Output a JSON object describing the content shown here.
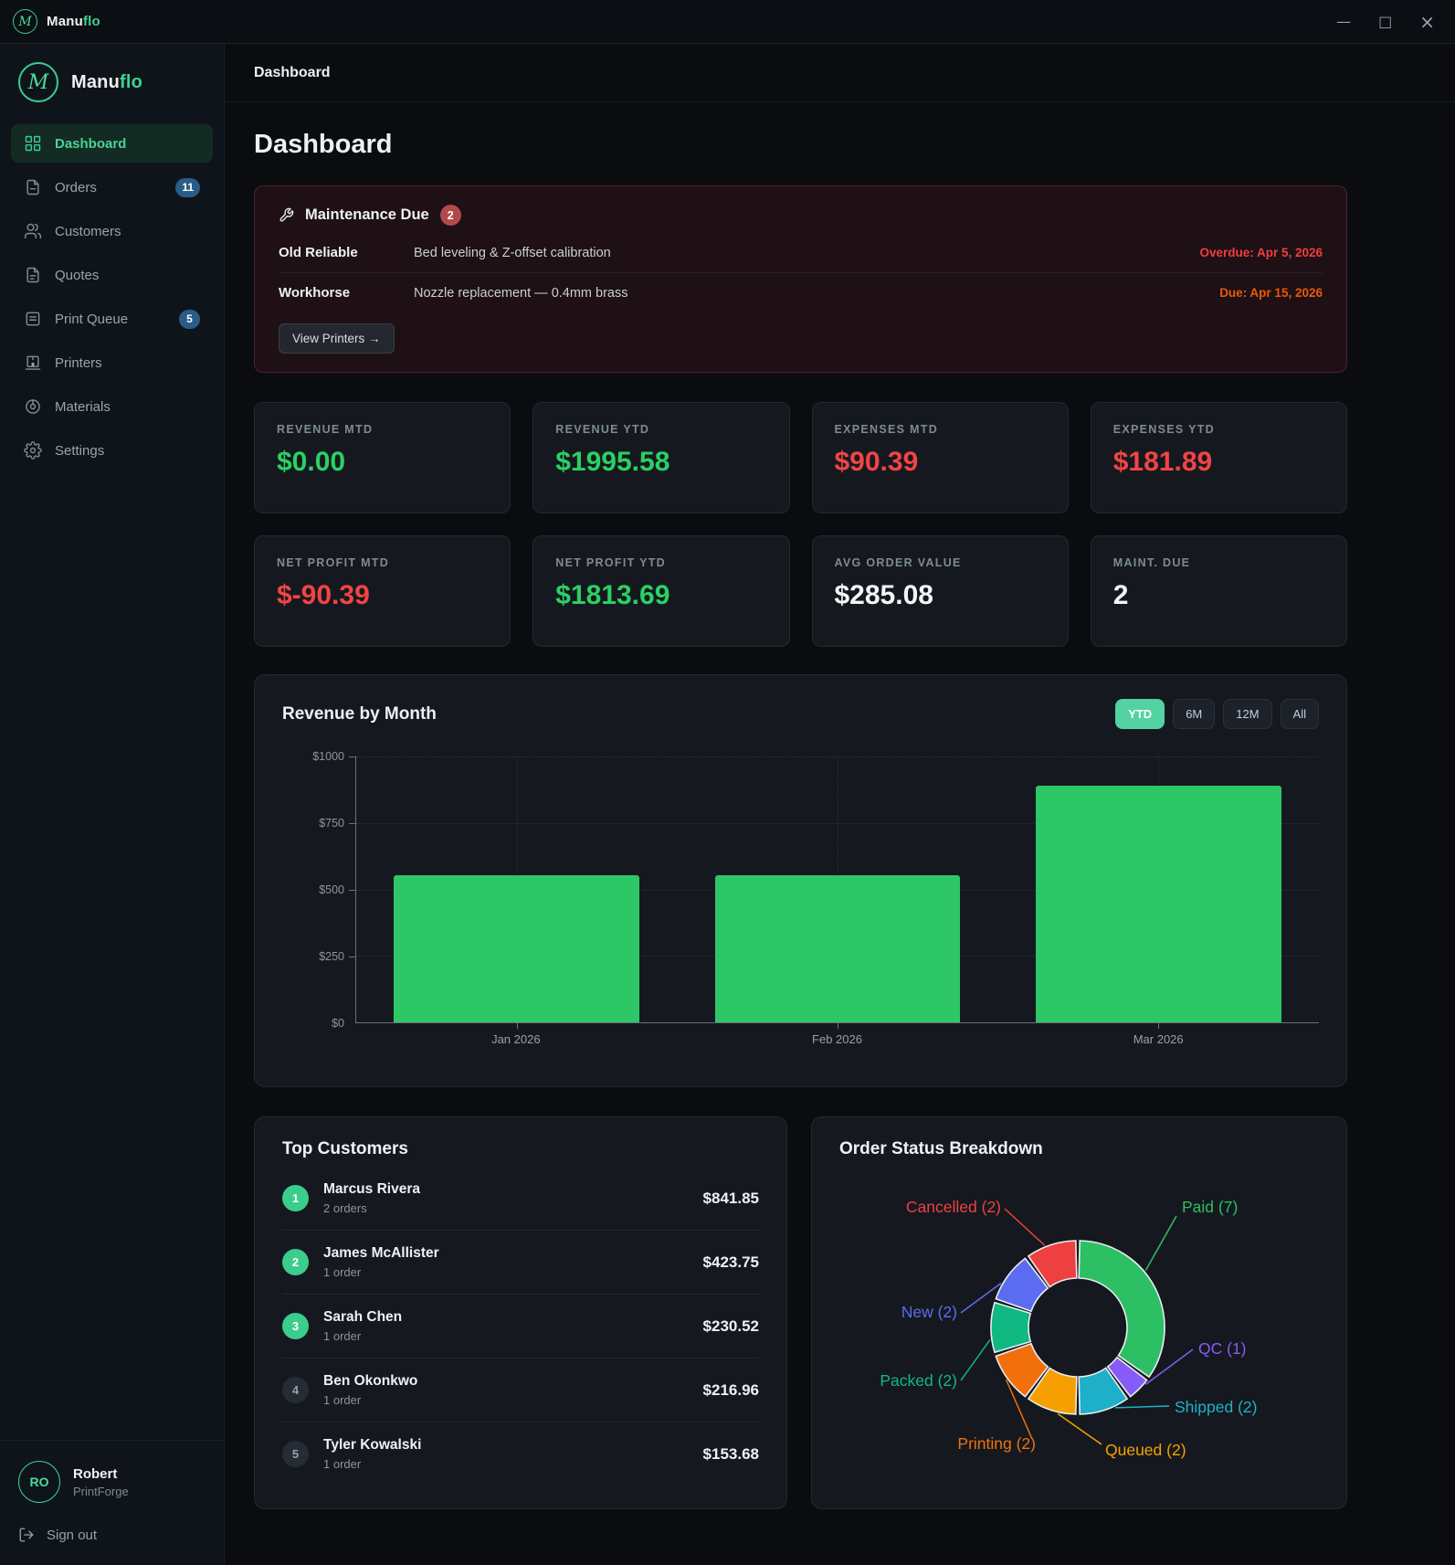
{
  "app": {
    "name_primary": "Manu",
    "name_accent": "flo",
    "logo_letter": "M"
  },
  "window_controls": {
    "minimize": "—",
    "maximize": "□",
    "close": "×"
  },
  "breadcrumb": "Dashboard",
  "page_title": "Dashboard",
  "sidebar": {
    "items": [
      {
        "label": "Dashboard",
        "icon": "dashboard-icon",
        "active": true
      },
      {
        "label": "Orders",
        "icon": "orders-icon",
        "badge": "11"
      },
      {
        "label": "Customers",
        "icon": "customers-icon"
      },
      {
        "label": "Quotes",
        "icon": "quotes-icon"
      },
      {
        "label": "Print Queue",
        "icon": "print-queue-icon",
        "badge": "5"
      },
      {
        "label": "Printers",
        "icon": "printers-icon"
      },
      {
        "label": "Materials",
        "icon": "materials-icon"
      },
      {
        "label": "Settings",
        "icon": "settings-icon"
      }
    ],
    "user": {
      "initials": "RO",
      "name": "Robert",
      "company": "PrintForge",
      "signout_label": "Sign out"
    }
  },
  "maintenance": {
    "title": "Maintenance Due",
    "badge": "2",
    "rows": [
      {
        "printer": "Old Reliable",
        "task": "Bed leveling & Z-offset calibration",
        "due": "Overdue: Apr 5, 2026",
        "status": "overdue"
      },
      {
        "printer": "Workhorse",
        "task": "Nozzle replacement — 0.4mm brass",
        "due": "Due: Apr 15, 2026",
        "status": "duesoon"
      }
    ],
    "button_label": "View Printers →"
  },
  "kpis": [
    {
      "label": "REVENUE MTD",
      "value": "$0.00",
      "tone": "green"
    },
    {
      "label": "REVENUE YTD",
      "value": "$1995.58",
      "tone": "green"
    },
    {
      "label": "EXPENSES MTD",
      "value": "$90.39",
      "tone": "red"
    },
    {
      "label": "EXPENSES YTD",
      "value": "$181.89",
      "tone": "red"
    },
    {
      "label": "NET PROFIT MTD",
      "value": "$-90.39",
      "tone": "red"
    },
    {
      "label": "NET PROFIT YTD",
      "value": "$1813.69",
      "tone": "green"
    },
    {
      "label": "AVG ORDER VALUE",
      "value": "$285.08",
      "tone": "white"
    },
    {
      "label": "MAINT. DUE",
      "value": "2",
      "tone": "white"
    }
  ],
  "revenue_chart": {
    "title": "Revenue by Month",
    "range_buttons": [
      "YTD",
      "6M",
      "12M",
      "All"
    ],
    "active_range": "YTD"
  },
  "chart_data": [
    {
      "type": "bar",
      "title": "Revenue by Month",
      "categories": [
        "Jan 2026",
        "Feb 2026",
        "Mar 2026"
      ],
      "values": [
        553,
        553,
        890
      ],
      "ylim": [
        0,
        1000
      ],
      "ytick_labels": [
        "$1000",
        "$750",
        "$500",
        "$250",
        "$0"
      ],
      "bar_color": "#2ec768",
      "grid": "dotted",
      "legend_position": "none"
    },
    {
      "type": "pie",
      "donut": true,
      "title": "Order Status Breakdown",
      "labels": [
        "Paid",
        "QC",
        "Shipped",
        "Queued",
        "Printing",
        "Packed",
        "New",
        "Cancelled"
      ],
      "values": [
        7,
        1,
        2,
        2,
        2,
        2,
        2,
        2
      ],
      "colors": [
        "#2cbf63",
        "#875bf7",
        "#1fb0c9",
        "#f5a000",
        "#f2700c",
        "#10b981",
        "#5c6cf2",
        "#ee4040"
      ]
    }
  ],
  "top_customers": {
    "title": "Top Customers",
    "rows": [
      {
        "rank": "1",
        "name": "Marcus Rivera",
        "orders": "2 orders",
        "amount": "$841.85"
      },
      {
        "rank": "2",
        "name": "James McAllister",
        "orders": "1 order",
        "amount": "$423.75"
      },
      {
        "rank": "3",
        "name": "Sarah Chen",
        "orders": "1 order",
        "amount": "$230.52"
      },
      {
        "rank": "4",
        "name": "Ben Okonkwo",
        "orders": "1 order",
        "amount": "$216.96"
      },
      {
        "rank": "5",
        "name": "Tyler Kowalski",
        "orders": "1 order",
        "amount": "$153.68"
      }
    ]
  },
  "order_status": {
    "title": "Order Status Breakdown"
  }
}
